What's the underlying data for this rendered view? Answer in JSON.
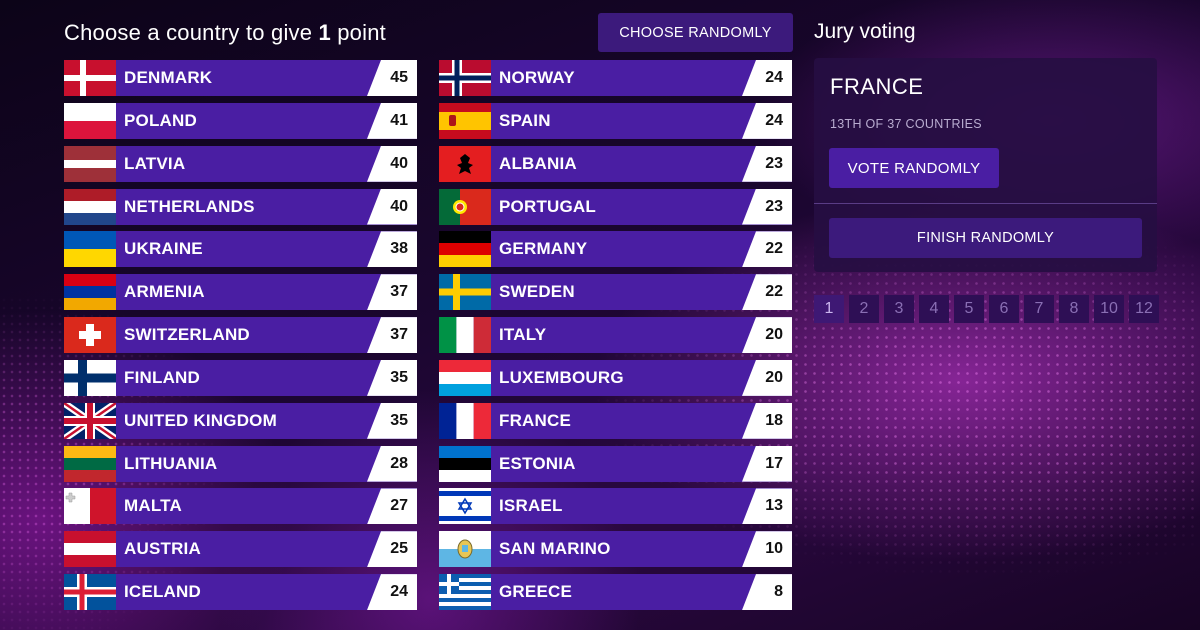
{
  "header": {
    "prefix": "Choose a country to give ",
    "points_value": "1",
    "suffix": " point",
    "choose_randomly": "CHOOSE RANDOMLY"
  },
  "jury": {
    "title": "Jury voting",
    "country": "FRANCE",
    "rank_text": "13TH OF 37 COUNTRIES",
    "vote_randomly": "VOTE RANDOMLY",
    "finish_randomly": "FINISH RANDOMLY"
  },
  "point_buttons": [
    "1",
    "2",
    "3",
    "4",
    "5",
    "6",
    "7",
    "8",
    "10",
    "12"
  ],
  "countries_left": [
    {
      "name": "DENMARK",
      "score": "45",
      "flag": "denmark-flag-icon"
    },
    {
      "name": "POLAND",
      "score": "41",
      "flag": "poland-flag-icon"
    },
    {
      "name": "LATVIA",
      "score": "40",
      "flag": "latvia-flag-icon"
    },
    {
      "name": "NETHERLANDS",
      "score": "40",
      "flag": "netherlands-flag-icon"
    },
    {
      "name": "UKRAINE",
      "score": "38",
      "flag": "ukraine-flag-icon"
    },
    {
      "name": "ARMENIA",
      "score": "37",
      "flag": "armenia-flag-icon"
    },
    {
      "name": "SWITZERLAND",
      "score": "37",
      "flag": "switzerland-flag-icon"
    },
    {
      "name": "FINLAND",
      "score": "35",
      "flag": "finland-flag-icon"
    },
    {
      "name": "UNITED KINGDOM",
      "score": "35",
      "flag": "united-kingdom-flag-icon"
    },
    {
      "name": "LITHUANIA",
      "score": "28",
      "flag": "lithuania-flag-icon"
    },
    {
      "name": "MALTA",
      "score": "27",
      "flag": "malta-flag-icon"
    },
    {
      "name": "AUSTRIA",
      "score": "25",
      "flag": "austria-flag-icon"
    },
    {
      "name": "ICELAND",
      "score": "24",
      "flag": "iceland-flag-icon"
    }
  ],
  "countries_right": [
    {
      "name": "NORWAY",
      "score": "24",
      "flag": "norway-flag-icon"
    },
    {
      "name": "SPAIN",
      "score": "24",
      "flag": "spain-flag-icon"
    },
    {
      "name": "ALBANIA",
      "score": "23",
      "flag": "albania-flag-icon"
    },
    {
      "name": "PORTUGAL",
      "score": "23",
      "flag": "portugal-flag-icon"
    },
    {
      "name": "GERMANY",
      "score": "22",
      "flag": "germany-flag-icon"
    },
    {
      "name": "SWEDEN",
      "score": "22",
      "flag": "sweden-flag-icon"
    },
    {
      "name": "ITALY",
      "score": "20",
      "flag": "italy-flag-icon"
    },
    {
      "name": "LUXEMBOURG",
      "score": "20",
      "flag": "luxembourg-flag-icon"
    },
    {
      "name": "FRANCE",
      "score": "18",
      "flag": "france-flag-icon"
    },
    {
      "name": "ESTONIA",
      "score": "17",
      "flag": "estonia-flag-icon"
    },
    {
      "name": "ISRAEL",
      "score": "13",
      "flag": "israel-flag-icon"
    },
    {
      "name": "SAN MARINO",
      "score": "10",
      "flag": "san-marino-flag-icon"
    },
    {
      "name": "GREECE",
      "score": "8",
      "flag": "greece-flag-icon"
    }
  ],
  "colors": {
    "row_bg": "#4a1ea3",
    "button_bg": "#3c1a7c",
    "panel_bg": "#260e42",
    "score_bg": "#ffffff"
  }
}
